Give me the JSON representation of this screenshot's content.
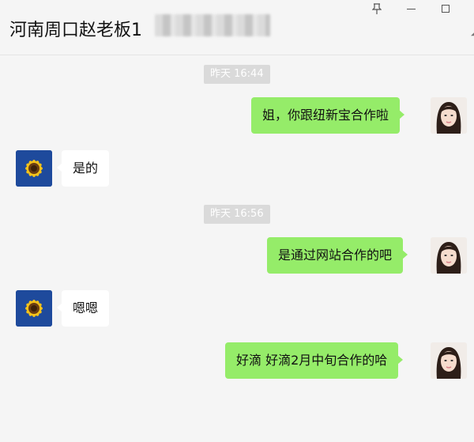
{
  "header": {
    "title": "河南周口赵老板1",
    "window_controls": {
      "pin": "pin-icon",
      "minimize": "minimize-icon",
      "maximize": "maximize-icon"
    }
  },
  "colors": {
    "background": "#f5f5f5",
    "self_bubble": "#95ec69",
    "other_bubble": "#ffffff",
    "timestamp_bg": "#dadada"
  },
  "messages": [
    {
      "type": "timestamp",
      "text": "昨天 16:44"
    },
    {
      "type": "message",
      "sender": "self",
      "text": "姐，你跟纽新宝合作啦"
    },
    {
      "type": "message",
      "sender": "other",
      "text": "是的"
    },
    {
      "type": "timestamp",
      "text": "昨天 16:56"
    },
    {
      "type": "message",
      "sender": "self",
      "text": "是通过网站合作的吧"
    },
    {
      "type": "message",
      "sender": "other",
      "text": "嗯嗯"
    },
    {
      "type": "message",
      "sender": "self",
      "text": "好滴 好滴2月中旬合作的哈"
    }
  ]
}
